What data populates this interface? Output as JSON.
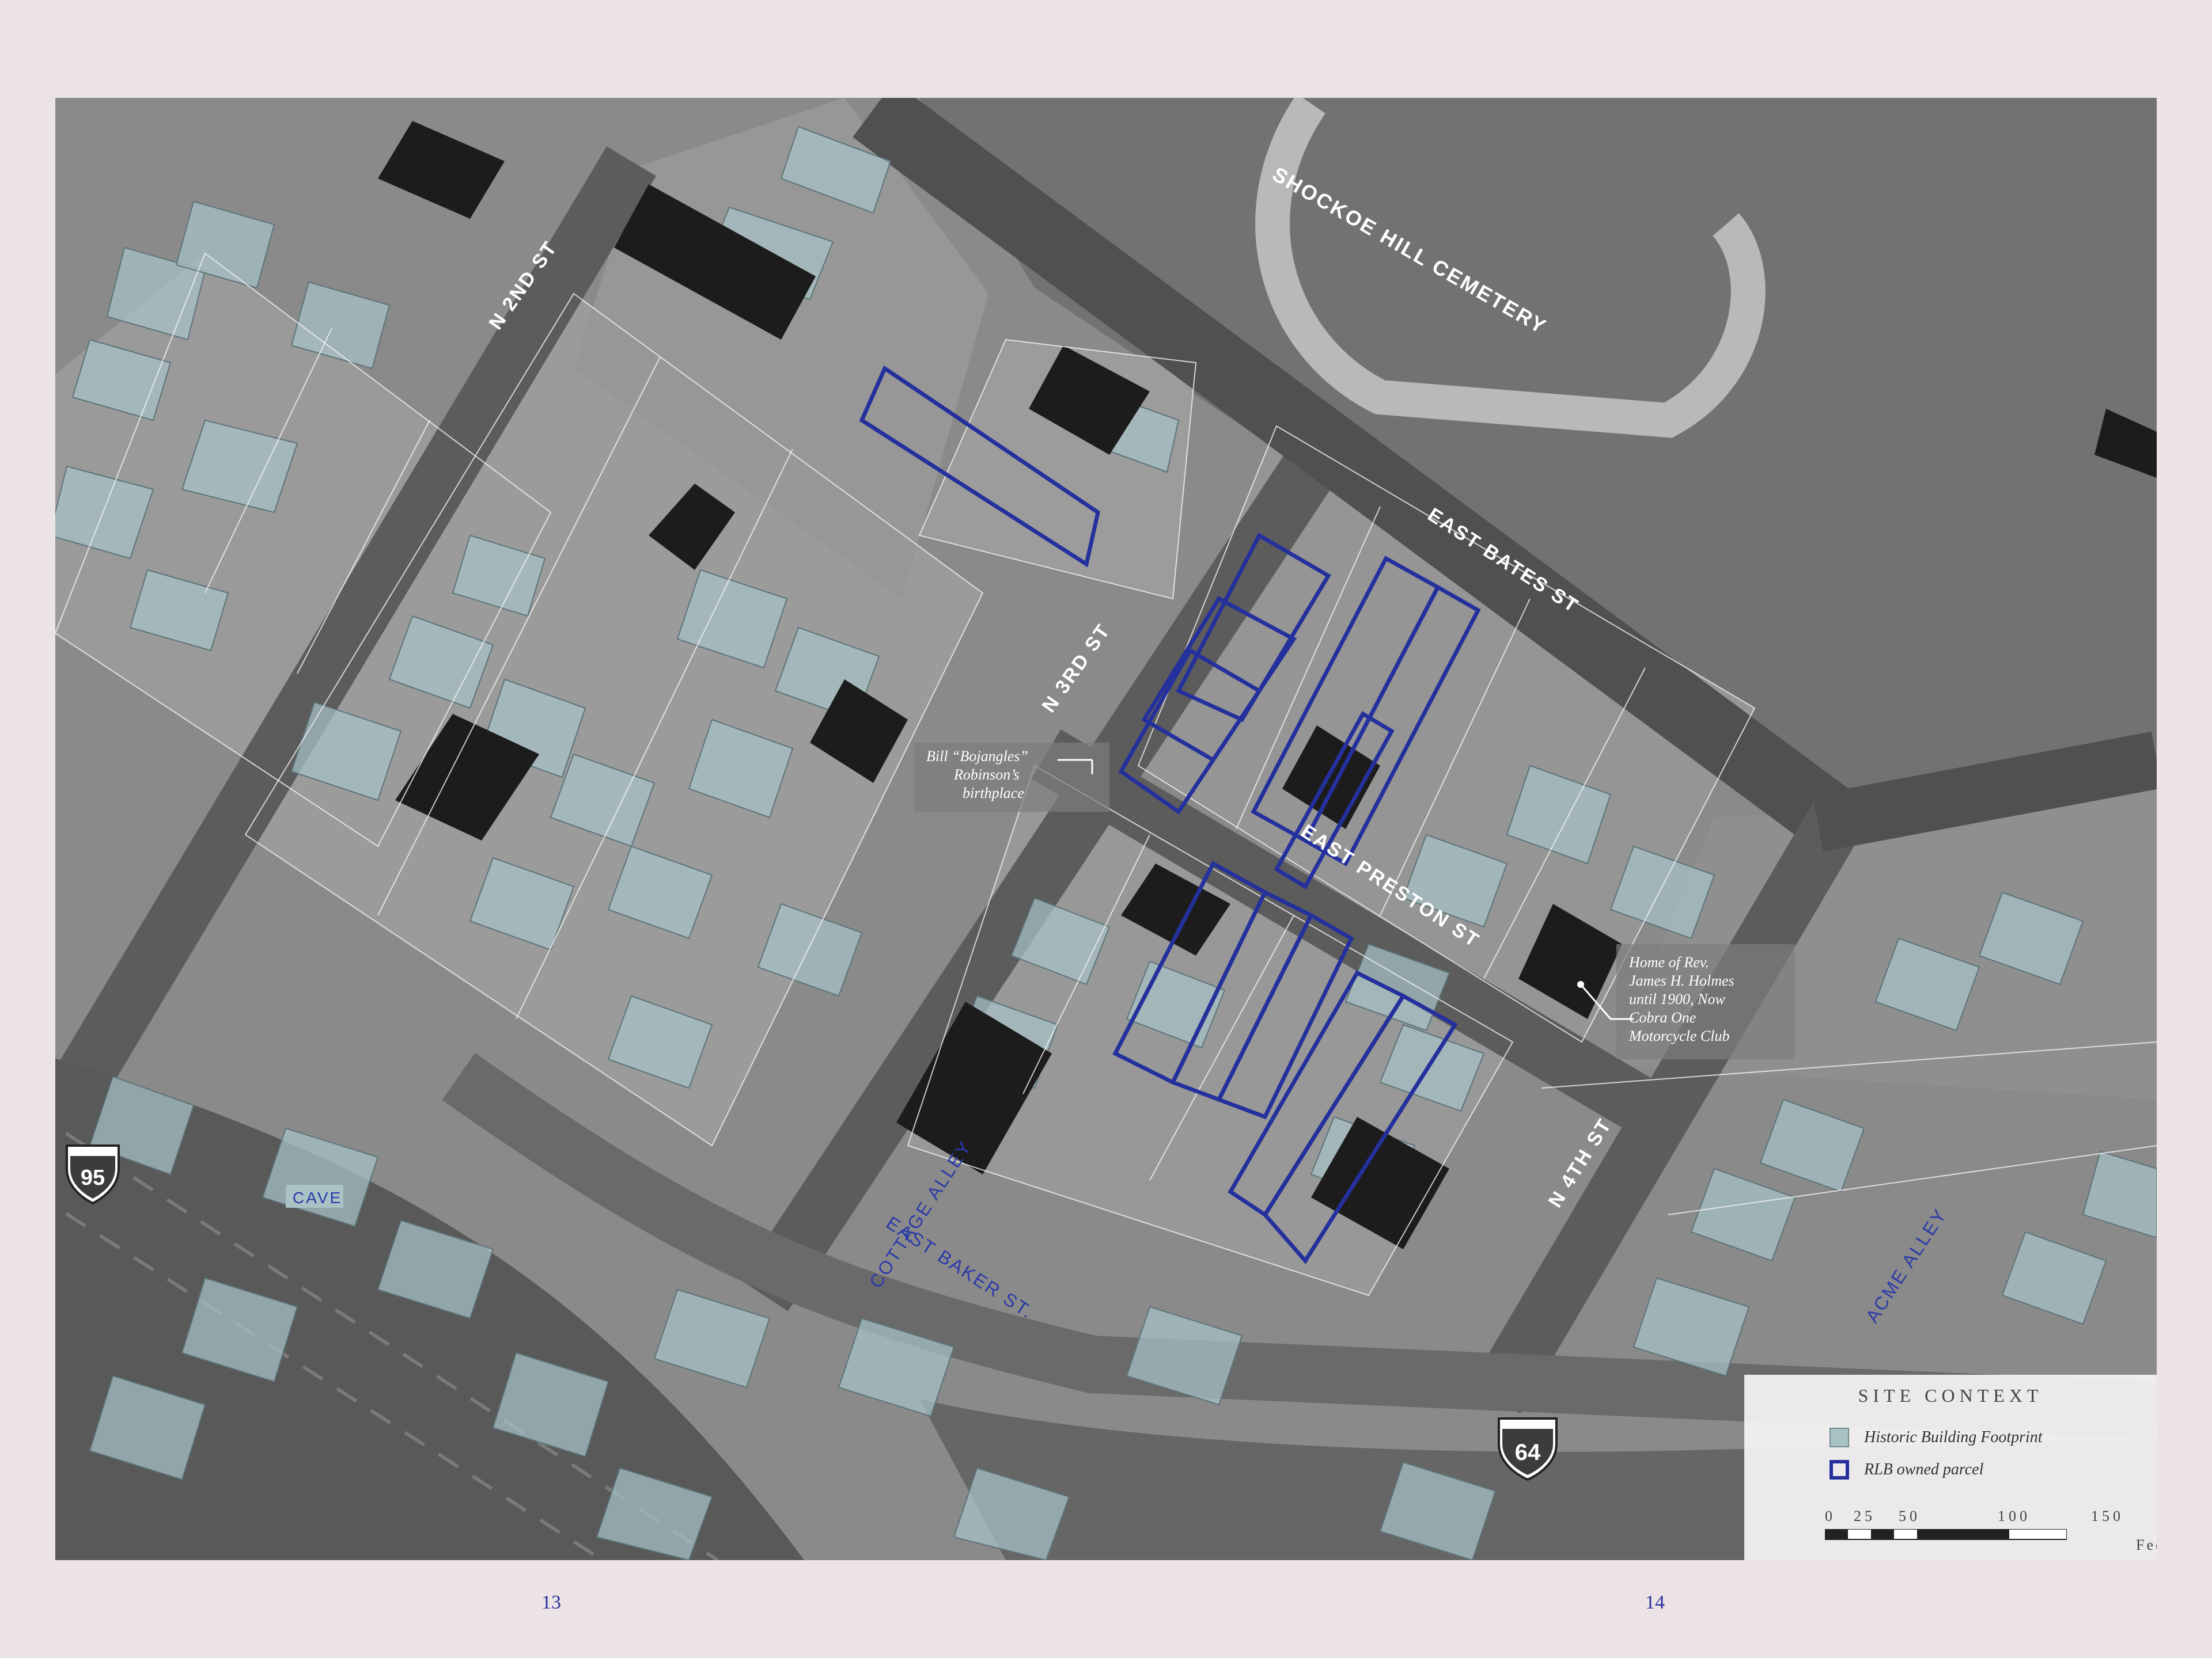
{
  "map": {
    "streets": {
      "n2nd": "N 2ND ST",
      "n3rd": "N 3RD ST",
      "n4th": "N 4TH ST",
      "east_bates": "EAST BATES ST",
      "east_preston": "EAST PRESTON ST",
      "east_baker": "EAST BAKER ST.",
      "cemetery": "SHOCKOE HILL CEMETERY"
    },
    "alleys": {
      "cottage": "COTTAGE ALLEY",
      "acme": "ACME ALLEY",
      "cave": "CAVE"
    },
    "shields": {
      "i95": "95",
      "i64": "64"
    },
    "annotations": {
      "bojangles": [
        "Bill “Bojangles”",
        "Robinson’s",
        "birthplace"
      ],
      "holmes": [
        "Home of Rev.",
        "James H. Holmes",
        "until 1900, Now",
        "Cobra One",
        "Motorcycle Club"
      ]
    }
  },
  "legend": {
    "title": "SITE CONTEXT",
    "items": [
      {
        "label": "Historic Building Footprint",
        "color": "#a8c2c6"
      },
      {
        "label": "RLB owned parcel",
        "color": "#24309c"
      }
    ],
    "scale": {
      "ticks": [
        "0",
        "25",
        "50",
        "100",
        "150"
      ],
      "unit": "Fee"
    }
  },
  "pages": {
    "left": "13",
    "right": "14"
  },
  "colors": {
    "page_bg": "#ece3e6",
    "parcel_outline": "#24309c",
    "footprint": "#a8c2c6",
    "page_number": "#2b2f9e"
  }
}
